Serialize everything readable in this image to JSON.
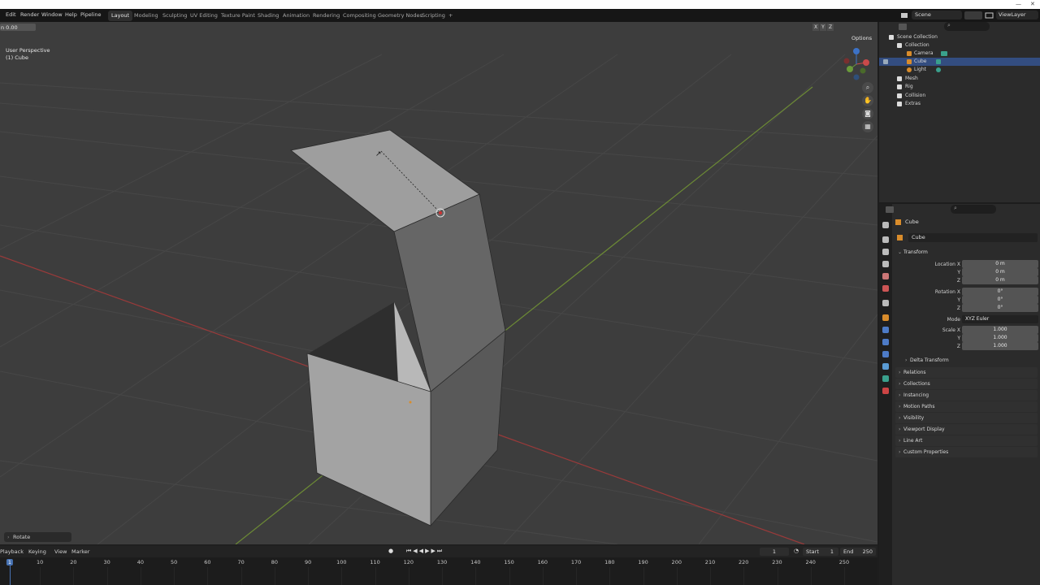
{
  "top_menu": [
    "Edit",
    "Render",
    "Window",
    "Help",
    "Pipeline"
  ],
  "workspace_tabs": [
    "Layout",
    "Modeling",
    "Sculpting",
    "UV Editing",
    "Texture Paint",
    "Shading",
    "Animation",
    "Rendering",
    "Compositing",
    "Geometry Nodes",
    "Scripting",
    "+"
  ],
  "active_tab": "Layout",
  "scene_name": "Scene",
  "view_layer": "ViewLayer",
  "window_controls": {
    "minimize": "—",
    "close": "✕"
  },
  "viewport": {
    "frame_readout": "n 0.00",
    "perspective": "User Perspective",
    "object": "(1) Cube",
    "options_label": "Options",
    "xyz": [
      "X",
      "Y",
      "Z"
    ],
    "operator_panel": "Rotate"
  },
  "outliner": {
    "root": "Scene Collection",
    "items": [
      {
        "label": "Collection",
        "level": 1
      },
      {
        "label": "Camera",
        "level": 2
      },
      {
        "label": "Cube",
        "level": 2,
        "selected": true
      },
      {
        "label": "Light",
        "level": 2
      },
      {
        "label": "Mesh",
        "level": 1
      },
      {
        "label": "Rig",
        "level": 1
      },
      {
        "label": "Collision",
        "level": 1
      },
      {
        "label": "Extras",
        "level": 1
      }
    ]
  },
  "properties": {
    "object_name": "Cube",
    "datablock": "Cube",
    "transform_title": "Transform",
    "location_label": "Location X",
    "location": [
      "0 m",
      "0 m",
      "0 m"
    ],
    "rotation_label": "Rotation X",
    "rotation": [
      "0°",
      "0°",
      "0°"
    ],
    "mode_label": "Mode",
    "mode_value": "XYZ Euler",
    "scale_label": "Scale X",
    "scale": [
      "1.000",
      "1.000",
      "1.000"
    ],
    "axis_y": "Y",
    "axis_z": "Z",
    "delta": "Delta Transform",
    "panels": [
      "Relations",
      "Collections",
      "Instancing",
      "Motion Paths",
      "Visibility",
      "Viewport Display",
      "Line Art",
      "Custom Properties"
    ]
  },
  "timeline": {
    "menus": [
      "Playback",
      "Keying",
      "View",
      "Marker"
    ],
    "current_frame": "1",
    "start_label": "Start",
    "start": "1",
    "end_label": "End",
    "end": "250",
    "ruler": [
      "1",
      "10",
      "20",
      "30",
      "40",
      "50",
      "60",
      "70",
      "80",
      "90",
      "100",
      "110",
      "120",
      "130",
      "140",
      "150",
      "160",
      "170",
      "180",
      "190",
      "200",
      "210",
      "220",
      "230",
      "240",
      "250"
    ]
  },
  "colors": {
    "viewport_bg": "#3d3d3d",
    "x_axis": "#9a3a3a",
    "y_axis": "#6c8a35",
    "selection": "#334d80",
    "accent": "#4772b3"
  }
}
